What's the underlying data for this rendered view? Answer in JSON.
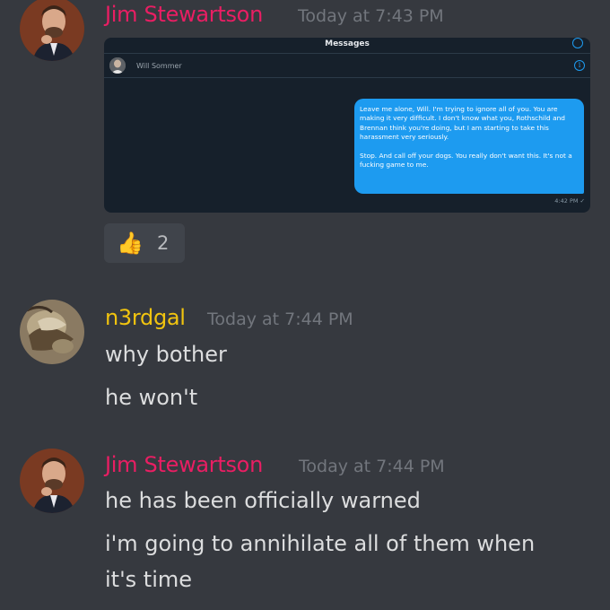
{
  "messages": [
    {
      "author": "Jim Stewartson",
      "author_color": "#e91e63",
      "timestamp": "Today at 7:43 PM",
      "embed": {
        "title": "Messages",
        "contact_name": "Will Sommer",
        "bubble_paragraph_1": "Leave me alone, Will. I'm trying to ignore all of you. You are making it very difficult. I don't know what you, Rothschild and Brennan think you're doing, but I am starting to take this harassment very seriously.",
        "bubble_paragraph_2": "Stop. And call off your dogs. You really don't want this. It's not a fucking game to me.",
        "time": "4:42 PM ✓"
      },
      "reaction": {
        "emoji": "thumbs-up",
        "count": "2"
      }
    },
    {
      "author": "n3rdgal",
      "author_color": "#f1c40f",
      "timestamp": "Today at 7:44 PM",
      "lines": [
        "why bother",
        "he won't"
      ]
    },
    {
      "author": "Jim Stewartson",
      "author_color": "#e91e63",
      "timestamp": "Today at 7:44 PM",
      "lines": [
        "he has been officially warned",
        "i'm going to annihilate all of them when",
        "it's time"
      ]
    }
  ],
  "colors": {
    "background": "#36393f",
    "timestamp": "#72767d",
    "text": "#dcddde",
    "bubble": "#1d9bf0"
  }
}
